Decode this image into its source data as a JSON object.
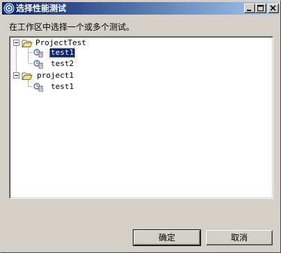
{
  "window": {
    "title": "选择性能测试",
    "icon": "eclipse-icon"
  },
  "instruction": "在工作区中选择一个或多个测试。",
  "tree": [
    {
      "label": "ProjectTest",
      "type": "project",
      "expanded": true,
      "children": [
        {
          "label": "test1",
          "type": "test",
          "selected": true
        },
        {
          "label": "test2",
          "type": "test",
          "selected": false
        }
      ]
    },
    {
      "label": "project1",
      "type": "project",
      "expanded": true,
      "children": [
        {
          "label": "test1",
          "type": "test",
          "selected": false
        }
      ]
    }
  ],
  "buttons": {
    "ok": "确定",
    "cancel": "取消"
  },
  "colors": {
    "selection": "#0a246a",
    "titlebar_start": "#0a246a",
    "titlebar_end": "#a6caf0",
    "face": "#d4d0c8"
  }
}
